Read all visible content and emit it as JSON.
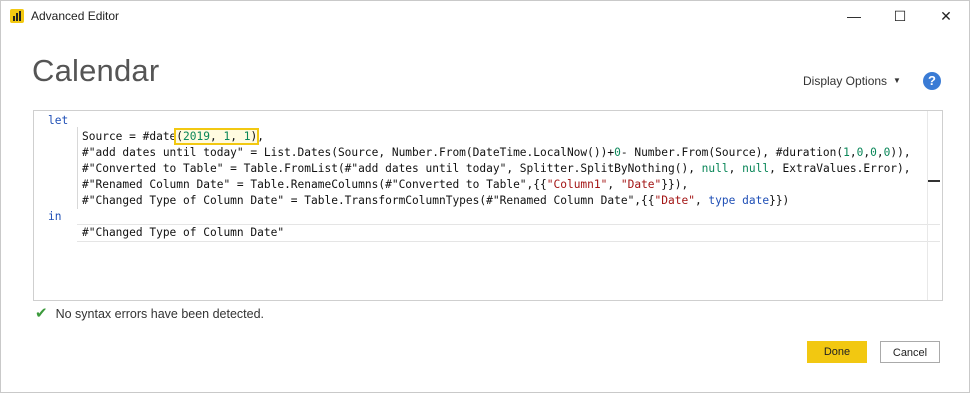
{
  "window": {
    "title": "Advanced Editor",
    "minimize_glyph": "—",
    "maximize_glyph": "☐",
    "close_glyph": "✕"
  },
  "header": {
    "query_name": "Calendar",
    "display_options_label": "Display Options",
    "help_glyph": "?"
  },
  "editor": {
    "kw_let": "let",
    "kw_in": "in",
    "line1": [
      "Source = #date",
      "(",
      "2019",
      ", ",
      "1",
      ", ",
      "1",
      ")",
      ","
    ],
    "line2": [
      "#\"add dates until today\" = List.Dates(Source, Number.From(DateTime.LocalNow())+",
      "0",
      "- Number.From(Source), #duration(",
      "1",
      ",",
      "0",
      ",",
      "0",
      ",",
      "0",
      ")),"
    ],
    "line3": [
      "#\"Converted to Table\" = Table.FromList(#\"add dates until today\", Splitter.SplitByNothing(), ",
      "null",
      ", ",
      "null",
      ", ExtraValues.Error),"
    ],
    "line4": [
      "#\"Renamed Column Date\" = Table.RenameColumns(#\"Converted to Table\",{{",
      "\"Column1\"",
      ", ",
      "\"Date\"",
      "}}),"
    ],
    "line5": [
      "#\"Changed Type of Column Date\" = Table.TransformColumnTypes(#\"Renamed Column Date\",{{",
      "\"Date\"",
      ", ",
      "type",
      " ",
      "date",
      "}})"
    ],
    "result_line": "#\"Changed Type of Column Date\""
  },
  "status": {
    "icon": "checkmark-icon",
    "message": "No syntax errors have been detected."
  },
  "buttons": {
    "done": "Done",
    "cancel": "Cancel"
  },
  "colors": {
    "accent": "#f2c811",
    "keyword": "#1f4fb6",
    "number": "#098658",
    "string": "#a31515",
    "success": "#3c9a3c"
  }
}
